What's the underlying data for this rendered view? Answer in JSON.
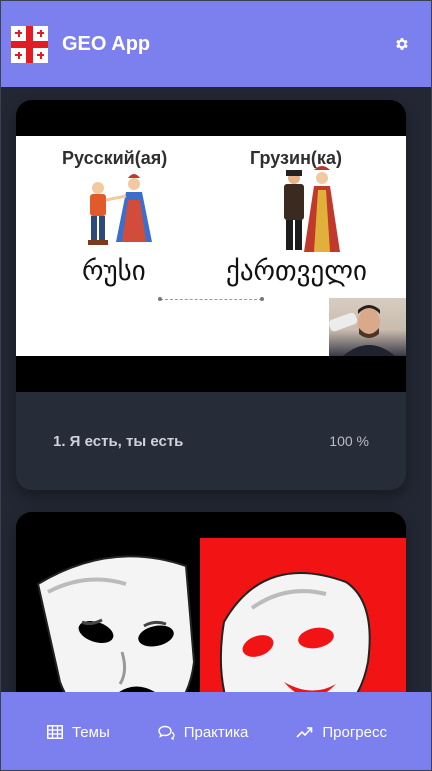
{
  "app": {
    "title": "GEO App",
    "accent_color": "#7c7fee",
    "logo_icon": "georgian-flag-icon",
    "settings_icon": "gear-icon"
  },
  "lessons": [
    {
      "title": "1. Я есть, ты есть",
      "progress": "100 %",
      "slide": {
        "left_label": "Русский(ая)",
        "right_label": "Грузин(ка)",
        "left_word": "რუსი",
        "right_word": "ქართველი"
      }
    },
    {
      "title": "",
      "progress": "",
      "thumbnail": "theatre-masks-image"
    }
  ],
  "bottom_nav": {
    "items": [
      {
        "label": "Темы",
        "icon": "table-icon"
      },
      {
        "label": "Практика",
        "icon": "chat-bubbles-icon"
      },
      {
        "label": "Прогресс",
        "icon": "trending-up-icon"
      }
    ]
  }
}
